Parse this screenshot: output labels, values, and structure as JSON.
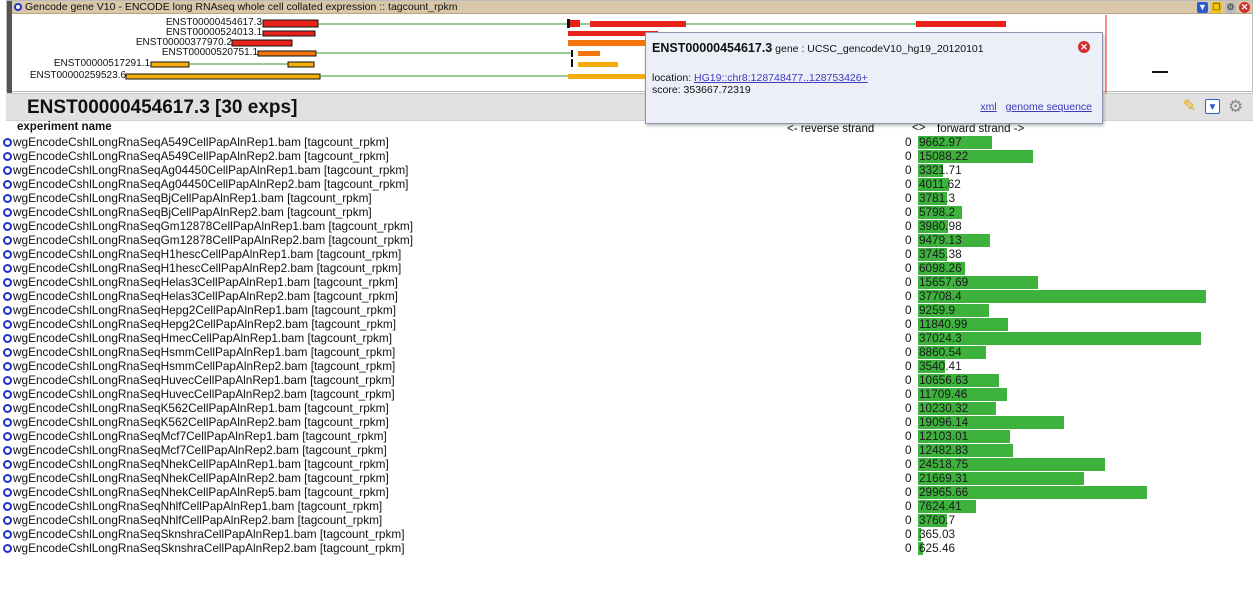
{
  "track": {
    "title": "Gencode gene V10 - ENCODE long RNAseq whole cell collated expression :: tagcount_rpkm",
    "transcripts": [
      {
        "label": "ENST00000454617.3"
      },
      {
        "label": "ENST00000524013.1"
      },
      {
        "label": "ENST00000377970.2"
      },
      {
        "label": "ENST00000520751.1"
      },
      {
        "label": "ENST00000517291.1"
      },
      {
        "label": "ENST00000259523.6"
      }
    ],
    "colors": {
      "red": "#e8221a",
      "orange": "#f5760f",
      "yellow": "#f4ad0a",
      "intron": "#2f9a2f"
    },
    "icons": [
      "download-icon",
      "copy-icon",
      "gear-icon",
      "close-icon"
    ]
  },
  "popup": {
    "id": "ENST00000454617.3",
    "gene_label": "gene : UCSC_gencodeV10_hg19_20120101",
    "location_label": "location:",
    "location_link": "HG19::chr8:128748477..128753426+",
    "score": "score: 353667.72319",
    "xml_link": "xml",
    "genome_link": "genome sequence"
  },
  "panel": {
    "title": "ENST00000454617.3 [30 exps]",
    "col_experiment": "experiment name",
    "col_reverse": "<- reverse strand",
    "col_swap": "<>",
    "col_forward": "forward strand ->",
    "bar_color": "#3db33d",
    "max_value": 37708.4,
    "experiments": [
      {
        "name": "wgEncodeCshlLongRnaSeqA549CellPapAlnRep1.bam [tagcount_rpkm]",
        "reverse": "0",
        "forward": "9662.97",
        "value": 9662.97
      },
      {
        "name": "wgEncodeCshlLongRnaSeqA549CellPapAlnRep2.bam [tagcount_rpkm]",
        "reverse": "0",
        "forward": "15088.22",
        "value": 15088.22
      },
      {
        "name": "wgEncodeCshlLongRnaSeqAg04450CellPapAlnRep1.bam [tagcount_rpkm]",
        "reverse": "0",
        "forward": "3321.71",
        "value": 3321.71
      },
      {
        "name": "wgEncodeCshlLongRnaSeqAg04450CellPapAlnRep2.bam [tagcount_rpkm]",
        "reverse": "0",
        "forward": "4011.62",
        "value": 4011.62
      },
      {
        "name": "wgEncodeCshlLongRnaSeqBjCellPapAlnRep1.bam [tagcount_rpkm]",
        "reverse": "0",
        "forward": "3781.3",
        "value": 3781.3
      },
      {
        "name": "wgEncodeCshlLongRnaSeqBjCellPapAlnRep2.bam [tagcount_rpkm]",
        "reverse": "0",
        "forward": "5798.2",
        "value": 5798.2
      },
      {
        "name": "wgEncodeCshlLongRnaSeqGm12878CellPapAlnRep1.bam [tagcount_rpkm]",
        "reverse": "0",
        "forward": "3980.98",
        "value": 3980.98
      },
      {
        "name": "wgEncodeCshlLongRnaSeqGm12878CellPapAlnRep2.bam [tagcount_rpkm]",
        "reverse": "0",
        "forward": "9479.13",
        "value": 9479.13
      },
      {
        "name": "wgEncodeCshlLongRnaSeqH1hescCellPapAlnRep1.bam [tagcount_rpkm]",
        "reverse": "0",
        "forward": "3745.38",
        "value": 3745.38
      },
      {
        "name": "wgEncodeCshlLongRnaSeqH1hescCellPapAlnRep2.bam [tagcount_rpkm]",
        "reverse": "0",
        "forward": "6098.26",
        "value": 6098.26
      },
      {
        "name": "wgEncodeCshlLongRnaSeqHelas3CellPapAlnRep1.bam [tagcount_rpkm]",
        "reverse": "0",
        "forward": "15657.69",
        "value": 15657.69
      },
      {
        "name": "wgEncodeCshlLongRnaSeqHelas3CellPapAlnRep2.bam [tagcount_rpkm]",
        "reverse": "0",
        "forward": "37708.4",
        "value": 37708.4
      },
      {
        "name": "wgEncodeCshlLongRnaSeqHepg2CellPapAlnRep1.bam [tagcount_rpkm]",
        "reverse": "0",
        "forward": "9259.9",
        "value": 9259.9
      },
      {
        "name": "wgEncodeCshlLongRnaSeqHepg2CellPapAlnRep2.bam [tagcount_rpkm]",
        "reverse": "0",
        "forward": "11840.99",
        "value": 11840.99
      },
      {
        "name": "wgEncodeCshlLongRnaSeqHmecCellPapAlnRep1.bam [tagcount_rpkm]",
        "reverse": "0",
        "forward": "37024.3",
        "value": 37024.3
      },
      {
        "name": "wgEncodeCshlLongRnaSeqHsmmCellPapAlnRep1.bam [tagcount_rpkm]",
        "reverse": "0",
        "forward": "8860.54",
        "value": 8860.54
      },
      {
        "name": "wgEncodeCshlLongRnaSeqHsmmCellPapAlnRep2.bam [tagcount_rpkm]",
        "reverse": "0",
        "forward": "3540.41",
        "value": 3540.41
      },
      {
        "name": "wgEncodeCshlLongRnaSeqHuvecCellPapAlnRep1.bam [tagcount_rpkm]",
        "reverse": "0",
        "forward": "10656.63",
        "value": 10656.63
      },
      {
        "name": "wgEncodeCshlLongRnaSeqHuvecCellPapAlnRep2.bam [tagcount_rpkm]",
        "reverse": "0",
        "forward": "11709.46",
        "value": 11709.46
      },
      {
        "name": "wgEncodeCshlLongRnaSeqK562CellPapAlnRep1.bam [tagcount_rpkm]",
        "reverse": "0",
        "forward": "10230.32",
        "value": 10230.32
      },
      {
        "name": "wgEncodeCshlLongRnaSeqK562CellPapAlnRep2.bam [tagcount_rpkm]",
        "reverse": "0",
        "forward": "19096.14",
        "value": 19096.14
      },
      {
        "name": "wgEncodeCshlLongRnaSeqMcf7CellPapAlnRep1.bam [tagcount_rpkm]",
        "reverse": "0",
        "forward": "12103.01",
        "value": 12103.01
      },
      {
        "name": "wgEncodeCshlLongRnaSeqMcf7CellPapAlnRep2.bam [tagcount_rpkm]",
        "reverse": "0",
        "forward": "12482.83",
        "value": 12482.83
      },
      {
        "name": "wgEncodeCshlLongRnaSeqNhekCellPapAlnRep1.bam [tagcount_rpkm]",
        "reverse": "0",
        "forward": "24518.75",
        "value": 24518.75
      },
      {
        "name": "wgEncodeCshlLongRnaSeqNhekCellPapAlnRep2.bam [tagcount_rpkm]",
        "reverse": "0",
        "forward": "21669.31",
        "value": 21669.31
      },
      {
        "name": "wgEncodeCshlLongRnaSeqNhekCellPapAlnRep5.bam [tagcount_rpkm]",
        "reverse": "0",
        "forward": "29965.66",
        "value": 29965.66
      },
      {
        "name": "wgEncodeCshlLongRnaSeqNhlfCellPapAlnRep1.bam [tagcount_rpkm]",
        "reverse": "0",
        "forward": "7624.41",
        "value": 7624.41
      },
      {
        "name": "wgEncodeCshlLongRnaSeqNhlfCellPapAlnRep2.bam [tagcount_rpkm]",
        "reverse": "0",
        "forward": "3760.7",
        "value": 3760.7
      },
      {
        "name": "wgEncodeCshlLongRnaSeqSknshraCellPapAlnRep1.bam [tagcount_rpkm]",
        "reverse": "0",
        "forward": "365.03",
        "value": 365.03
      },
      {
        "name": "wgEncodeCshlLongRnaSeqSknshraCellPapAlnRep2.bam [tagcount_rpkm]",
        "reverse": "0",
        "forward": "625.46",
        "value": 625.46
      }
    ]
  }
}
